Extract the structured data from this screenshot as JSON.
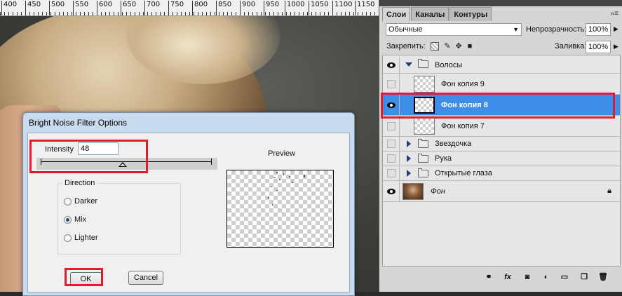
{
  "ruler": {
    "ticks": [
      "400",
      "450",
      "500",
      "550",
      "600",
      "650",
      "700",
      "750",
      "800",
      "850",
      "900",
      "950",
      "1000",
      "1050",
      "1100",
      "1150"
    ]
  },
  "dialog": {
    "title": "Bright Noise Filter Options",
    "intensity_label": "Intensity",
    "intensity_value": "48",
    "intensity_slider_fraction": 0.48,
    "direction": {
      "legend": "Direction",
      "options": [
        "Darker",
        "Mix",
        "Lighter"
      ],
      "selected": "Mix"
    },
    "preview_label": "Preview",
    "ok_label": "OK",
    "cancel_label": "Cancel"
  },
  "panel": {
    "tabs": [
      "Слои",
      "Каналы",
      "Контуры"
    ],
    "active_tab": "Слои",
    "menu_icon": "»≡",
    "blend_mode": "Обычные",
    "opacity_label": "Непрозрачность:",
    "opacity_value": "100%",
    "lock_label": "Закрепить:",
    "fill_label": "Заливка:",
    "fill_value": "100%",
    "layers": [
      {
        "name": "Волосы",
        "type": "group",
        "visible": true,
        "expanded": true
      },
      {
        "name": "Фон копия 9",
        "type": "layer",
        "visible": false
      },
      {
        "name": "Фон копия 8",
        "type": "layer",
        "visible": true,
        "selected": true
      },
      {
        "name": "Фон копия 7",
        "type": "layer",
        "visible": false
      },
      {
        "name": "Звездочка",
        "type": "group",
        "visible": false,
        "expanded": false
      },
      {
        "name": "Рука",
        "type": "group",
        "visible": false,
        "expanded": false
      },
      {
        "name": "Открытые глаза",
        "type": "group",
        "visible": false,
        "expanded": false
      },
      {
        "name": "Фон",
        "type": "background",
        "visible": true,
        "locked": true
      }
    ],
    "bottom_icons": [
      "link-icon",
      "fx-icon",
      "mask-icon",
      "adjustment-icon",
      "group-icon",
      "new-layer-icon",
      "trash-icon"
    ]
  },
  "colors": {
    "selection": "#3d8ee8",
    "highlight": "#e21c2b"
  }
}
